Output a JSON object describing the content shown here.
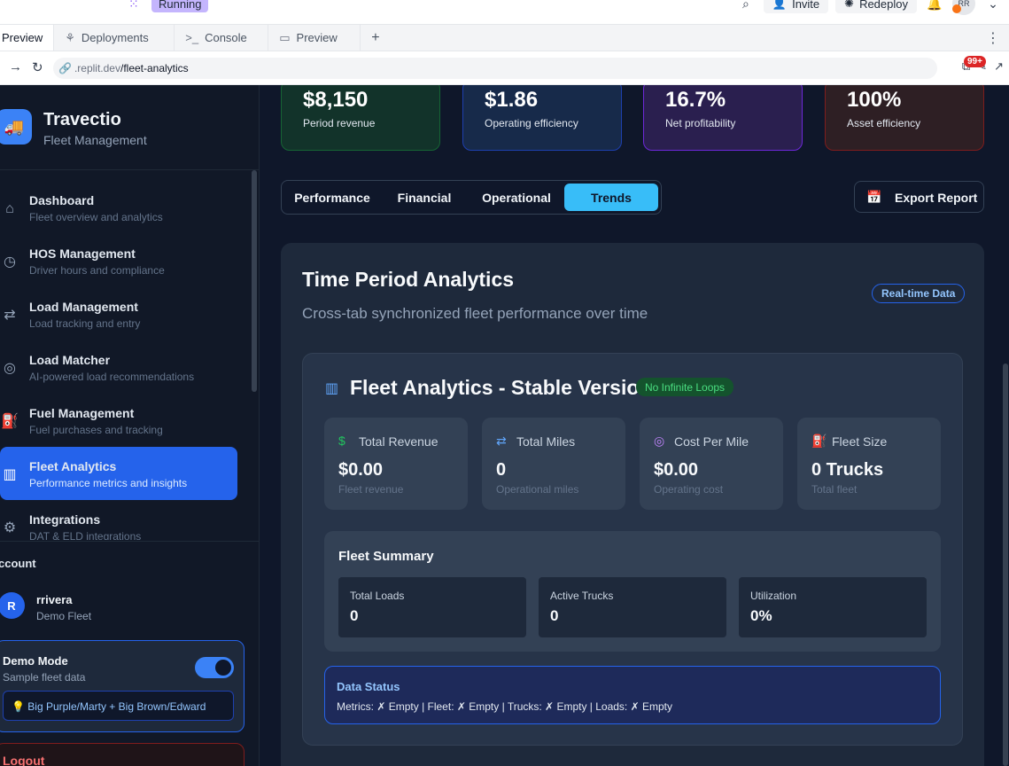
{
  "browser": {
    "running_label": "Running",
    "invite_label": "Invite",
    "redeploy_label": "Redeploy",
    "user_initials": "RR",
    "tabs": [
      {
        "label": "Preview"
      },
      {
        "label": "Deployments"
      },
      {
        "label": "Console"
      },
      {
        "label": "Preview"
      }
    ],
    "url_host": ".replit.dev",
    "url_path": "/fleet-analytics",
    "notification_count": "99+"
  },
  "sidebar": {
    "brand_name": "Travectio",
    "brand_sub": "Fleet Management",
    "items": [
      {
        "title": "Dashboard",
        "desc": "Fleet overview and analytics",
        "icon": "home-icon"
      },
      {
        "title": "HOS Management",
        "desc": "Driver hours and compliance",
        "icon": "clock-icon"
      },
      {
        "title": "Load Management",
        "desc": "Load tracking and entry",
        "icon": "route-icon"
      },
      {
        "title": "Load Matcher",
        "desc": "AI-powered load recommendations",
        "icon": "target-icon"
      },
      {
        "title": "Fuel Management",
        "desc": "Fuel purchases and tracking",
        "icon": "fuel-icon"
      },
      {
        "title": "Fleet Analytics",
        "desc": "Performance metrics and insights",
        "icon": "bar-chart-icon"
      },
      {
        "title": "Integrations",
        "desc": "DAT & ELD integrations",
        "icon": "gear-icon"
      }
    ],
    "account_label": "ccount",
    "user_initial": "R",
    "user_name": "rrivera",
    "user_fleet": "Demo Fleet",
    "demo_title": "Demo Mode",
    "demo_sub": "Sample fleet data",
    "demo_hint": "💡 Big Purple/Marty + Big Brown/Edward",
    "logout_label": "Logout"
  },
  "kpis": [
    {
      "value": "$8,150",
      "label": "Period revenue",
      "color": "#166534"
    },
    {
      "value": "$1.86",
      "label": "Operating efficiency",
      "color": "#1e40af"
    },
    {
      "value": "16.7%",
      "label": "Net profitability",
      "color": "#6d28d9"
    },
    {
      "value": "100%",
      "label": "Asset efficiency",
      "color": "#7f1d1d"
    }
  ],
  "tabs": {
    "items": [
      "Performance",
      "Financial",
      "Operational",
      "Trends"
    ],
    "active": "Trends"
  },
  "export_label": "Export Report",
  "card": {
    "title": "Time Period Analytics",
    "subtitle": "Cross-tab synchronized fleet performance over time",
    "badge": "Real-time Data"
  },
  "fleet": {
    "title": "Fleet Analytics - Stable Version",
    "badge": "No Infinite Loops",
    "stats": [
      {
        "label": "Total Revenue",
        "value": "$0.00",
        "desc": "Fleet revenue",
        "icon": "dollar-icon",
        "color": "#22c55e"
      },
      {
        "label": "Total Miles",
        "value": "0",
        "desc": "Operational miles",
        "icon": "route-icon",
        "color": "#60a5fa"
      },
      {
        "label": "Cost Per Mile",
        "value": "$0.00",
        "desc": "Operating cost",
        "icon": "target-icon",
        "color": "#c084fc"
      },
      {
        "label": "Fleet Size",
        "value": "0 Trucks",
        "desc": "Total fleet",
        "icon": "fuel-icon",
        "color": "#fb923c"
      }
    ],
    "summary_title": "Fleet Summary",
    "summary": [
      {
        "label": "Total Loads",
        "value": "0"
      },
      {
        "label": "Active Trucks",
        "value": "0"
      },
      {
        "label": "Utilization",
        "value": "0%"
      }
    ],
    "status_title": "Data Status",
    "status_text": "Metrics: ✗ Empty | Fleet: ✗ Empty | Trucks: ✗ Empty | Loads: ✗ Empty"
  }
}
